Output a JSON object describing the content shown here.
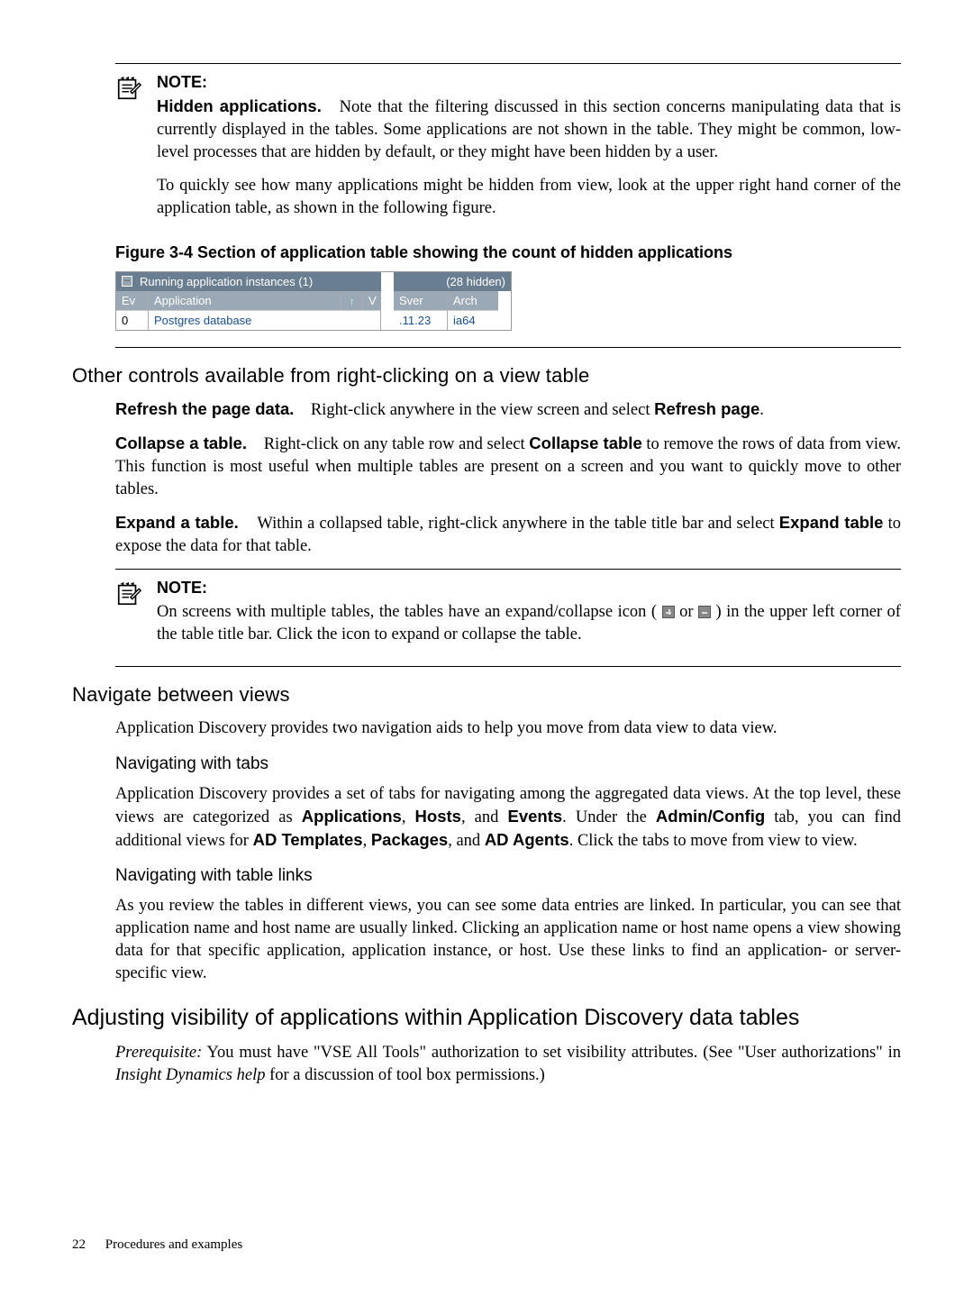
{
  "note1": {
    "label": "NOTE:",
    "lead": "Hidden applications.",
    "p1": "Note that the filtering discussed in this section concerns manipulating data that is currently displayed in the tables. Some applications are not shown in the table. They might be common, low-level processes that are hidden by default, or they might have been hidden by a user.",
    "p2": "To quickly see how many applications might be hidden from view, look at the upper right hand corner of the application table, as shown in the following figure."
  },
  "figure": {
    "caption": "Figure 3-4 Section of application table showing the count of hidden applications",
    "left_header": "Running application instances (1)",
    "right_header": "(28 hidden)",
    "cols": {
      "ev": "Ev",
      "app": "Application",
      "v": "V",
      "sver": "Sver",
      "arch": "Arch"
    },
    "row": {
      "ev": "0",
      "app": "Postgres database",
      "sver": ".11.23",
      "arch": "ia64"
    }
  },
  "otherControls": {
    "heading": "Other controls available from right-clicking on a view table",
    "refresh": {
      "lead": "Refresh the page data.",
      "text": "Right-click anywhere in the view screen and select ",
      "action": "Refresh page",
      "tail": "."
    },
    "collapse": {
      "lead": "Collapse a table.",
      "text": "Right-click on any table row and select ",
      "action": "Collapse table",
      "tail": " to remove the rows of data from view. This function is most useful when multiple tables are present on a screen and you want to quickly move to other tables."
    },
    "expand": {
      "lead": "Expand a table.",
      "text": "Within a collapsed table, right-click anywhere in the table title bar and select ",
      "action": "Expand table",
      "tail": " to expose the data for that table."
    }
  },
  "note2": {
    "label": "NOTE:",
    "pre": "On screens with multiple tables, the tables have an expand/collapse icon ( ",
    "mid": " or ",
    "post": " ) in the upper left corner of the table title bar. Click the icon to expand or collapse the table."
  },
  "navigate": {
    "heading": "Navigate between views",
    "intro": "Application Discovery provides two navigation aids to help you move from data view to data view.",
    "tabs": {
      "heading": "Navigating with tabs",
      "t1": "Application Discovery provides a set of tabs for navigating among the aggregated data views. At the top level, these views are categorized as ",
      "b1": "Applications",
      "c1": ", ",
      "b2": "Hosts",
      "c2": ", and ",
      "b3": "Events",
      "c3": ". Under the ",
      "b4": "Admin/Config",
      "c4": " tab, you can find additional views for ",
      "b5": "AD Templates",
      "c5": ", ",
      "b6": "Packages",
      "c6": ", and ",
      "b7": "AD Agents",
      "c7": ". Click the tabs to move from view to view."
    },
    "links": {
      "heading": "Navigating with table links",
      "text": "As you review the tables in different views, you can see some data entries are linked. In particular, you can see that application name and host name are usually linked. Clicking an application name or host name opens a view showing data for that specific application, application instance, or host. Use these links to find an application- or server-specific view."
    }
  },
  "section": {
    "heading": "Adjusting visibility of applications within Application Discovery data tables",
    "prereq_label": "Prerequisite:",
    "prereq_t1": "  You must have \"VSE All Tools\" authorization to set visibility attributes.  (See \"User authorizations\" in ",
    "prereq_em": "Insight Dynamics help",
    "prereq_t2": " for a discussion of tool box permissions.)"
  },
  "footer": {
    "page": "22",
    "chapter": "Procedures and examples"
  }
}
